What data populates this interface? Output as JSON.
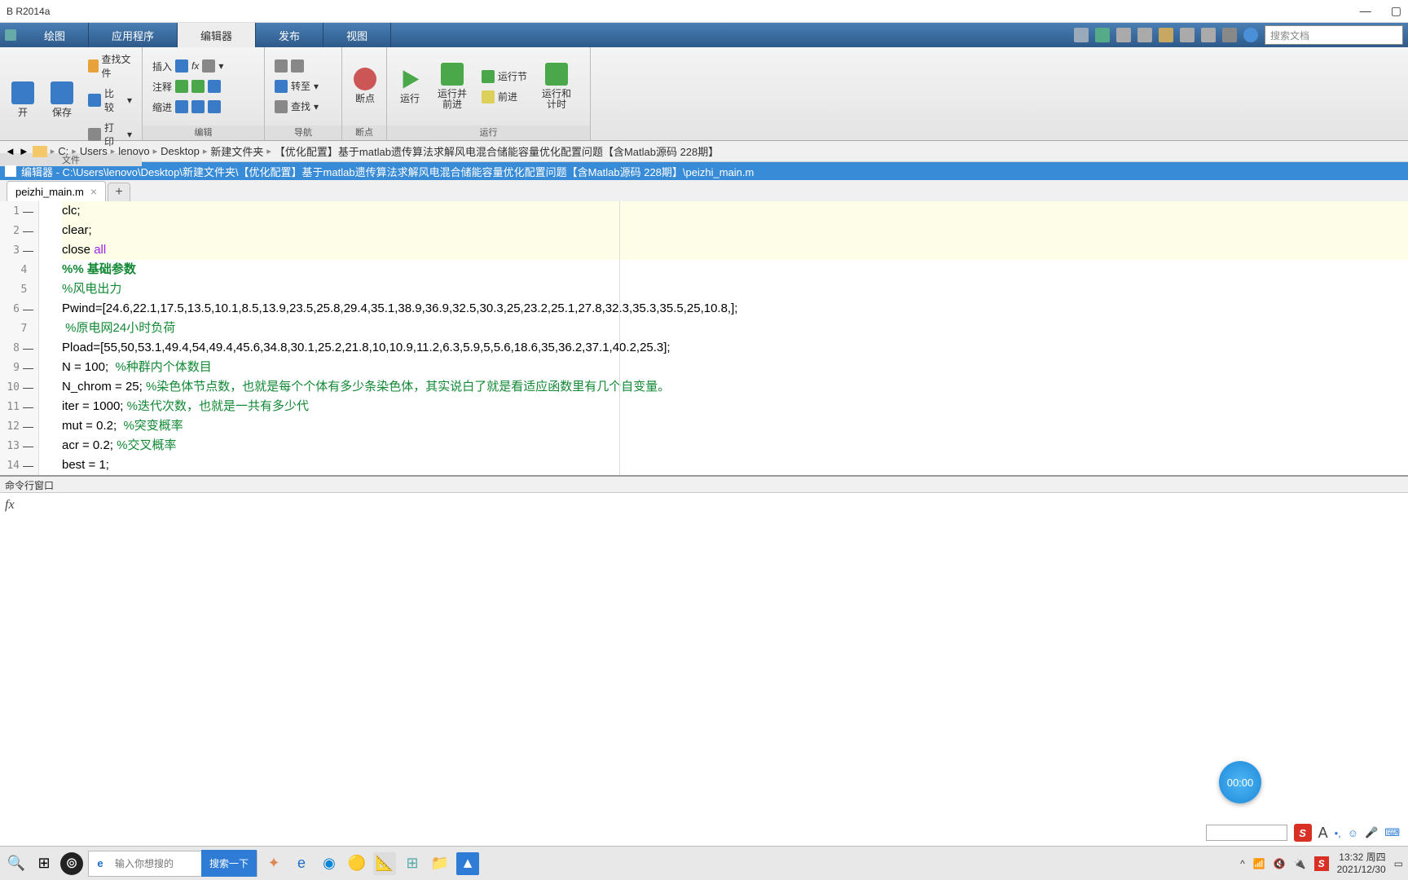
{
  "window": {
    "title": "B R2014a"
  },
  "maintabs": {
    "items": [
      "绘图",
      "应用程序",
      "编辑器",
      "发布",
      "视图"
    ],
    "active": 2,
    "search_placeholder": "搜索文档"
  },
  "ribbon": {
    "g_file": {
      "label": "文件",
      "open": "开",
      "save": "保存",
      "findfiles": "查找文件",
      "compare": "比较",
      "print": "打印"
    },
    "g_edit": {
      "label": "编辑",
      "insert": "插入",
      "fx": "fx",
      "comment": "注释",
      "indent": "缩进"
    },
    "g_nav": {
      "label": "导航",
      "goto": "转至",
      "find": "查找"
    },
    "g_break": {
      "label": "断点",
      "bp": "断点"
    },
    "g_run": {
      "label": "运行",
      "run": "运行",
      "runadv": "运行并\n前进",
      "runsec": "运行节",
      "adv": "前进",
      "runtime": "运行和\n计时"
    }
  },
  "address": {
    "segs": [
      "C:",
      "Users",
      "lenovo",
      "Desktop",
      "新建文件夹",
      "【优化配置】基于matlab遗传算法求解风电混合储能容量优化配置问题【含Matlab源码 228期】"
    ]
  },
  "editor_title": "编辑器 - C:\\Users\\lenovo\\Desktop\\新建文件夹\\【优化配置】基于matlab遗传算法求解风电混合储能容量优化配置问题【含Matlab源码 228期】\\peizhi_main.m",
  "filetab": {
    "name": "peizhi_main.m"
  },
  "code": {
    "lines": [
      {
        "n": 1,
        "d": true,
        "hl": true,
        "tokens": [
          {
            "t": "clc",
            "c": ""
          },
          {
            "t": ";",
            "c": ""
          }
        ]
      },
      {
        "n": 2,
        "d": true,
        "hl": true,
        "tokens": [
          {
            "t": "clear",
            "c": ""
          },
          {
            "t": ";",
            "c": ""
          }
        ]
      },
      {
        "n": 3,
        "d": true,
        "hl": true,
        "tokens": [
          {
            "t": "close ",
            "c": ""
          },
          {
            "t": "all",
            "c": "str"
          }
        ]
      },
      {
        "n": 4,
        "d": false,
        "hl": false,
        "tokens": [
          {
            "t": "%% 基础参数",
            "c": "sec"
          }
        ]
      },
      {
        "n": 5,
        "d": false,
        "hl": false,
        "tokens": [
          {
            "t": "%风电出力",
            "c": "com"
          }
        ]
      },
      {
        "n": 6,
        "d": true,
        "hl": false,
        "tokens": [
          {
            "t": "Pwind=[24.6,22.1,17.5,13.5,10.1,8.5,13.9,23.5,25.8,29.4,35.1,38.9,36.9,32.5,30.3,25,23.2,25.1,27.8,32.3,35.3,35.5,25,10.8,];",
            "c": ""
          }
        ]
      },
      {
        "n": 7,
        "d": false,
        "hl": false,
        "tokens": [
          {
            "t": " %原电网24小时负荷",
            "c": "com"
          }
        ]
      },
      {
        "n": 8,
        "d": true,
        "hl": false,
        "tokens": [
          {
            "t": "Pload=[55,50,53.1,49.4,54,49.4,45.6,34.8,30.1,25.2,21.8,10,10.9,11.2,6.3,5.9,5,5.6,18.6,35,36.2,37.1,40.2,25.3];",
            "c": ""
          }
        ]
      },
      {
        "n": 9,
        "d": true,
        "hl": false,
        "tokens": [
          {
            "t": "N = 100;  ",
            "c": ""
          },
          {
            "t": "%种群内个体数目",
            "c": "com"
          }
        ]
      },
      {
        "n": 10,
        "d": true,
        "hl": false,
        "tokens": [
          {
            "t": "N_chrom = 25; ",
            "c": ""
          },
          {
            "t": "%染色体节点数，也就是每个个体有多少条染色体，其实说白了就是看适应函数里有几个自变量。",
            "c": "com"
          }
        ]
      },
      {
        "n": 11,
        "d": true,
        "hl": false,
        "tokens": [
          {
            "t": "iter = 1000; ",
            "c": ""
          },
          {
            "t": "%迭代次数，也就是一共有多少代",
            "c": "com"
          }
        ]
      },
      {
        "n": 12,
        "d": true,
        "hl": false,
        "tokens": [
          {
            "t": "mut = 0.2;  ",
            "c": ""
          },
          {
            "t": "%突变概率",
            "c": "com"
          }
        ]
      },
      {
        "n": 13,
        "d": true,
        "hl": false,
        "tokens": [
          {
            "t": "acr = 0.2; ",
            "c": ""
          },
          {
            "t": "%交叉概率",
            "c": "com"
          }
        ]
      },
      {
        "n": 14,
        "d": true,
        "hl": false,
        "tokens": [
          {
            "t": "best = 1;",
            "c": ""
          }
        ]
      }
    ]
  },
  "cmd": {
    "title": "命令行窗口",
    "fx": "fx"
  },
  "timer": "00:00",
  "ime": {
    "s": "S",
    "a": "A"
  },
  "taskbar": {
    "search_placeholder": "输入你想搜的",
    "search_go": "搜索一下",
    "clock_time": "13:32 周四",
    "clock_date": "2021/12/30"
  }
}
